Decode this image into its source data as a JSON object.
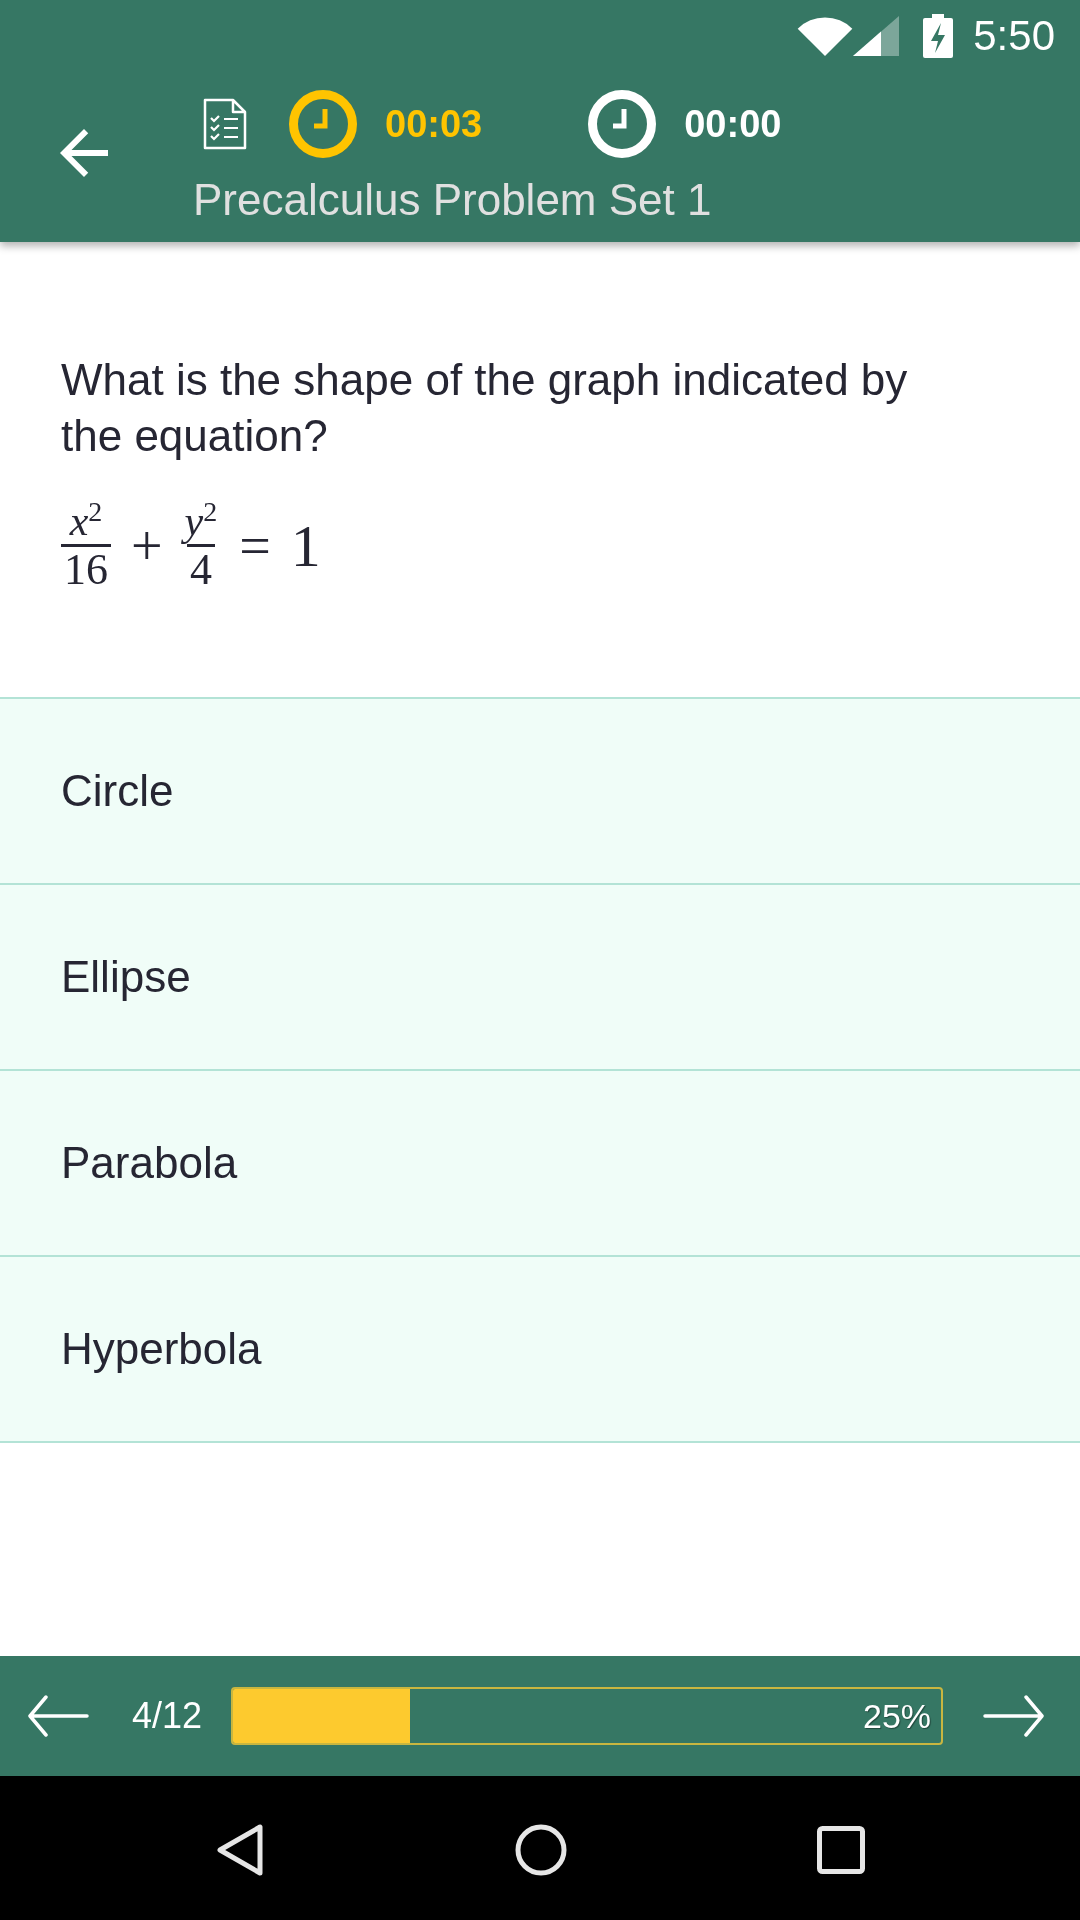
{
  "status_bar": {
    "time": "5:50"
  },
  "header": {
    "timers": [
      {
        "active": true,
        "time": "00:03"
      },
      {
        "active": false,
        "time": "00:00"
      }
    ],
    "title": "Precalculus Problem Set 1"
  },
  "question": {
    "text": "What is the shape of the graph indicated by the equation?",
    "equation": [
      {
        "kind": "fraction",
        "base": "x",
        "exponent": "2",
        "denominator": "16"
      },
      {
        "kind": "operator",
        "text": "+"
      },
      {
        "kind": "fraction",
        "base": "y",
        "exponent": "2",
        "denominator": "4"
      },
      {
        "kind": "operator",
        "text": "="
      },
      {
        "kind": "number",
        "text": "1"
      }
    ]
  },
  "options": [
    {
      "label": "Circle",
      "selected": false
    },
    {
      "label": "Ellipse",
      "selected": false
    },
    {
      "label": "Parabola",
      "selected": false
    },
    {
      "label": "Hyperbola",
      "selected": false
    }
  ],
  "footer": {
    "position": "4/12",
    "progress": {
      "level": 0.25,
      "reading": "25%"
    }
  }
}
